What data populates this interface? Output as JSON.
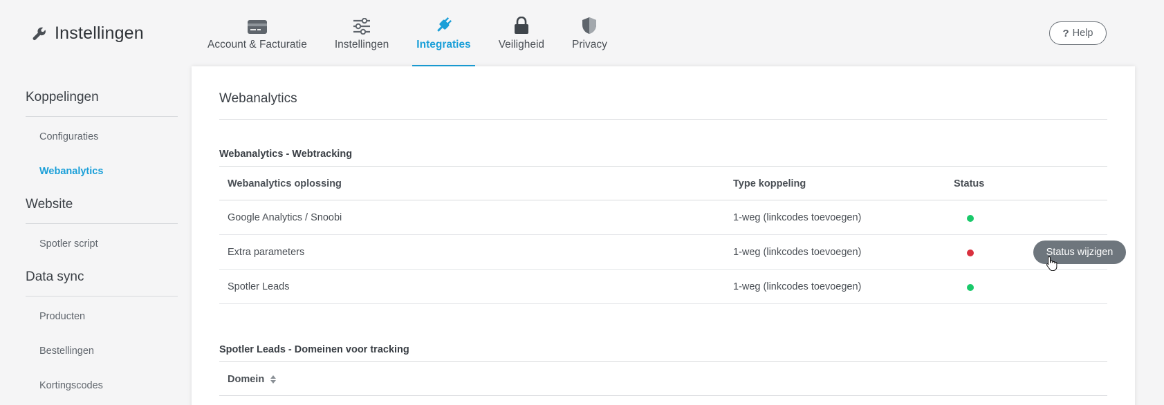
{
  "header": {
    "title": "Instellingen",
    "help_label": "Help"
  },
  "tabs": [
    {
      "label": "Account & Facturatie",
      "icon": "credit-card-icon"
    },
    {
      "label": "Instellingen",
      "icon": "sliders-icon"
    },
    {
      "label": "Integraties",
      "icon": "plug-icon",
      "active": true
    },
    {
      "label": "Veiligheid",
      "icon": "lock-icon"
    },
    {
      "label": "Privacy",
      "icon": "shield-icon"
    }
  ],
  "sidebar": {
    "sections": [
      {
        "heading": "Koppelingen",
        "items": [
          "Configuraties",
          "Webanalytics"
        ]
      },
      {
        "heading": "Website",
        "items": [
          "Spotler script"
        ]
      },
      {
        "heading": "Data sync",
        "items": [
          "Producten",
          "Bestellingen",
          "Kortingscodes"
        ]
      }
    ],
    "active_item": "Webanalytics"
  },
  "main": {
    "title": "Webanalytics",
    "tracking_section": {
      "title": "Webanalytics - Webtracking",
      "columns": [
        "Webanalytics oplossing",
        "Type koppeling",
        "Status"
      ],
      "rows": [
        {
          "name": "Google Analytics / Snoobi",
          "type": "1-weg (linkcodes toevoegen)",
          "status": "active"
        },
        {
          "name": "Extra parameters",
          "type": "1-weg (linkcodes toevoegen)",
          "status": "inactive",
          "action": "Status wijzigen"
        },
        {
          "name": "Spotler Leads",
          "type": "1-weg (linkcodes toevoegen)",
          "status": "active"
        }
      ]
    },
    "domains_section": {
      "title": "Spotler Leads - Domeinen voor tracking",
      "columns": [
        "Domein"
      ]
    }
  },
  "colors": {
    "accent": "#1a9fd8",
    "status_ok": "#19c96a",
    "status_error": "#d9303e",
    "button_gray": "#6e767d"
  }
}
